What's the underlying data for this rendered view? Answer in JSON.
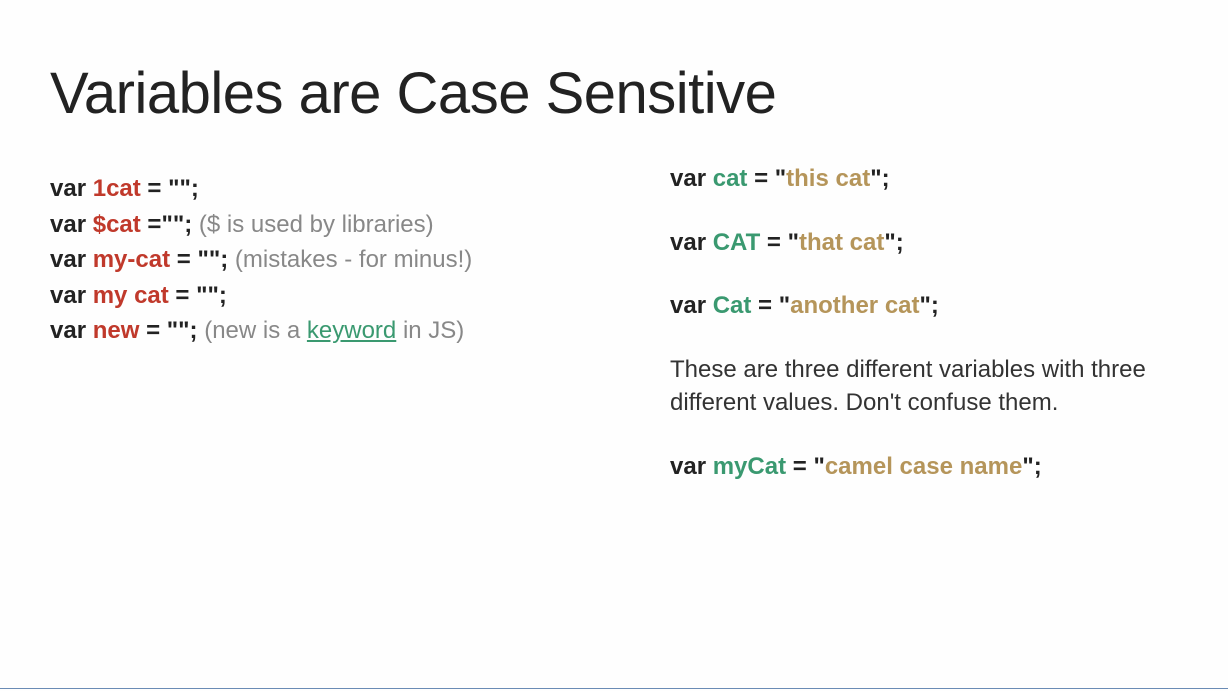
{
  "title": "Variables are Case Sensitive",
  "left": {
    "lines": [
      {
        "var": "var",
        "name": "1cat",
        "eq": " = ",
        "val": "\"\"",
        "end": ";",
        "comment": ""
      },
      {
        "var": "var",
        "name": "$cat",
        "eq": " =",
        "val": "\"\"",
        "end": ";",
        "comment": " ($ is used by libraries)"
      },
      {
        "var": "var",
        "name": "my-cat",
        "eq": " = ",
        "val": "\"\"",
        "end": ";",
        "comment": " (mistakes - for minus!)"
      },
      {
        "var": "var",
        "name": "my cat",
        "eq": " = ",
        "val": "\"\"",
        "end": ";",
        "comment": ""
      },
      {
        "var": "var",
        "name": "new",
        "eq": " = ",
        "val": "\"\"",
        "end": ";",
        "comment_pre": " (new is a ",
        "link": "keyword",
        "comment_post": " in JS)"
      }
    ]
  },
  "right": {
    "lines": [
      {
        "var": "var",
        "name": "cat",
        "eq": " = ",
        "q1": "\"",
        "val": "this cat",
        "q2": "\"",
        "end": ";"
      },
      {
        "var": "var",
        "name": "CAT",
        "eq": " = ",
        "q1": "\"",
        "val": "that cat",
        "q2": "\"",
        "end": ";"
      },
      {
        "var": "var",
        "name": "Cat",
        "eq": " = ",
        "q1": "\"",
        "val": "another cat",
        "q2": "\"",
        "end": ";"
      }
    ],
    "explain": "These are three different variables with three different values. Don't confuse them.",
    "final": {
      "var": "var",
      "name": "myCat",
      "eq": " = ",
      "q1": "\"",
      "val": "camel case name",
      "q2": "\"",
      "end": ";"
    }
  }
}
